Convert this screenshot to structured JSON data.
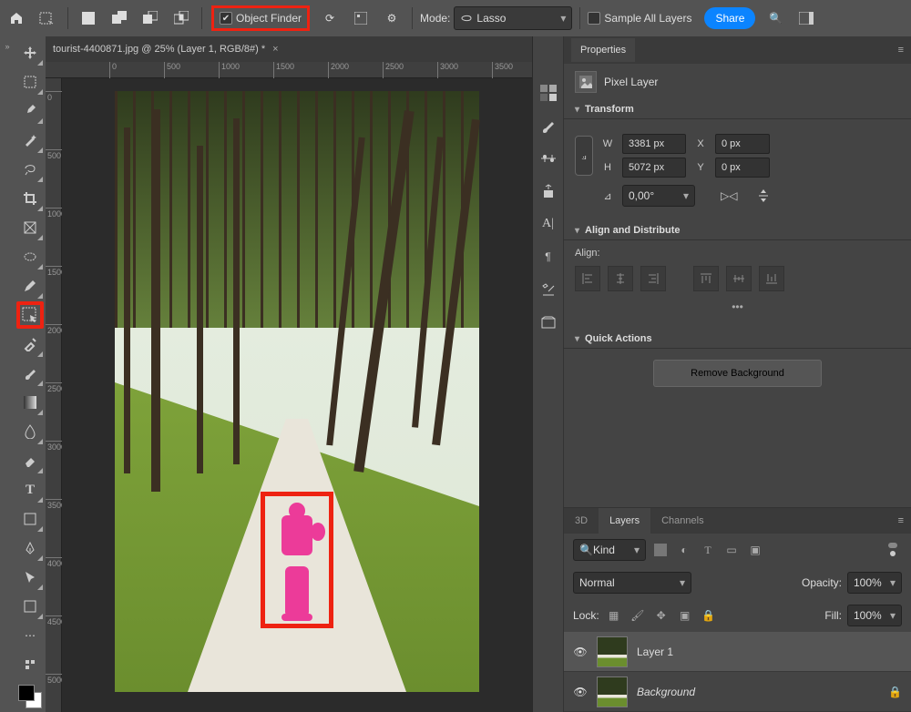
{
  "topbar": {
    "home_icon": "home-icon",
    "object_finder": {
      "label": "Object Finder",
      "checked": true
    },
    "mode_label": "Mode:",
    "mode_value": "Lasso",
    "sample_all": {
      "label": "Sample All Layers",
      "checked": false
    },
    "share_label": "Share"
  },
  "document": {
    "tab_title": "tourist-4400871.jpg @ 25% (Layer 1, RGB/8#) *",
    "ruler_h": [
      "0",
      "500",
      "1000",
      "1500",
      "2000",
      "2500",
      "3000",
      "3500"
    ],
    "ruler_v": [
      "0",
      "500",
      "1000",
      "1500",
      "2000",
      "2500",
      "3000",
      "3500",
      "4000",
      "4500",
      "5000"
    ]
  },
  "properties": {
    "tab": "Properties",
    "layer_type": "Pixel Layer",
    "transform": {
      "title": "Transform",
      "W_label": "W",
      "W": "3381 px",
      "H_label": "H",
      "H": "5072 px",
      "X_label": "X",
      "X": "0 px",
      "Y_label": "Y",
      "Y": "0 px",
      "angle_label": "△",
      "angle": "0,00°"
    },
    "align": {
      "title": "Align and Distribute",
      "subtitle": "Align:"
    },
    "quick": {
      "title": "Quick Actions",
      "remove_bg": "Remove Background"
    }
  },
  "layers": {
    "tabs": [
      "3D",
      "Layers",
      "Channels"
    ],
    "active_tab": "Layers",
    "kind_label": "Kind",
    "blend": "Normal",
    "opacity_label": "Opacity:",
    "opacity": "100%",
    "lock_label": "Lock:",
    "fill_label": "Fill:",
    "fill": "100%",
    "items": [
      {
        "name": "Layer 1",
        "visible": true,
        "locked": false,
        "active": true
      },
      {
        "name": "Background",
        "visible": true,
        "locked": true,
        "active": false
      }
    ]
  },
  "mini_tools": [
    "swatches-icon",
    "brush-icon",
    "adjustments-icon",
    "clone-icon",
    "text-icon",
    "paragraph-icon",
    "tools-icon",
    "library-icon"
  ]
}
